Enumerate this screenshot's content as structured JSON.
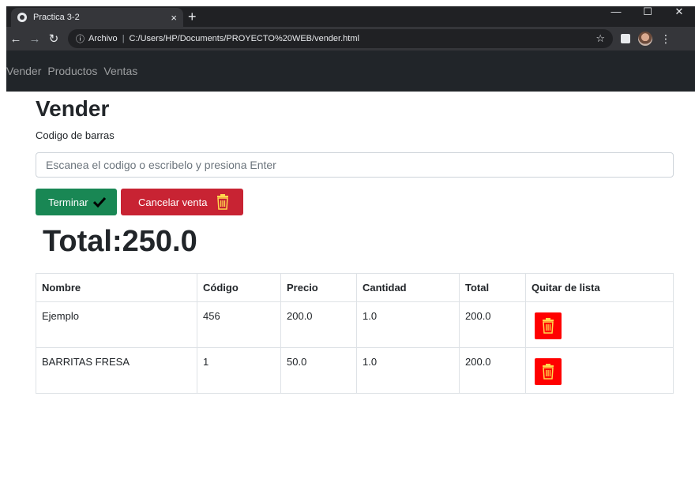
{
  "browser": {
    "tab_title": "Practica 3-2",
    "tab_close": "×",
    "new_tab": "+",
    "address_prefix": "Archivo",
    "address_url": "C:/Users/HP/Documents/PROYECTO%20WEB/vender.html"
  },
  "nav": {
    "items": [
      {
        "label": "Vender"
      },
      {
        "label": "Productos"
      },
      {
        "label": "Ventas"
      }
    ]
  },
  "page": {
    "title": "Vender",
    "barcode_label": "Codigo de barras",
    "barcode_placeholder": "Escanea el codigo o escribelo y presiona Enter",
    "finish_label": "Terminar",
    "cancel_label": "Cancelar venta",
    "total_text": "Total:250.0"
  },
  "table": {
    "headers": [
      "Nombre",
      "Código",
      "Precio",
      "Cantidad",
      "Total",
      "Quitar de lista"
    ],
    "rows": [
      [
        "Ejemplo",
        "456",
        "200.0",
        "1.0",
        "200.0"
      ],
      [
        "BARRITAS FRESA",
        "1",
        "50.0",
        "1.0",
        "200.0"
      ]
    ]
  },
  "colors": {
    "success": "#198754",
    "danger": "#c82333",
    "remove_button": "#ff0000",
    "navbar": "#212529"
  }
}
